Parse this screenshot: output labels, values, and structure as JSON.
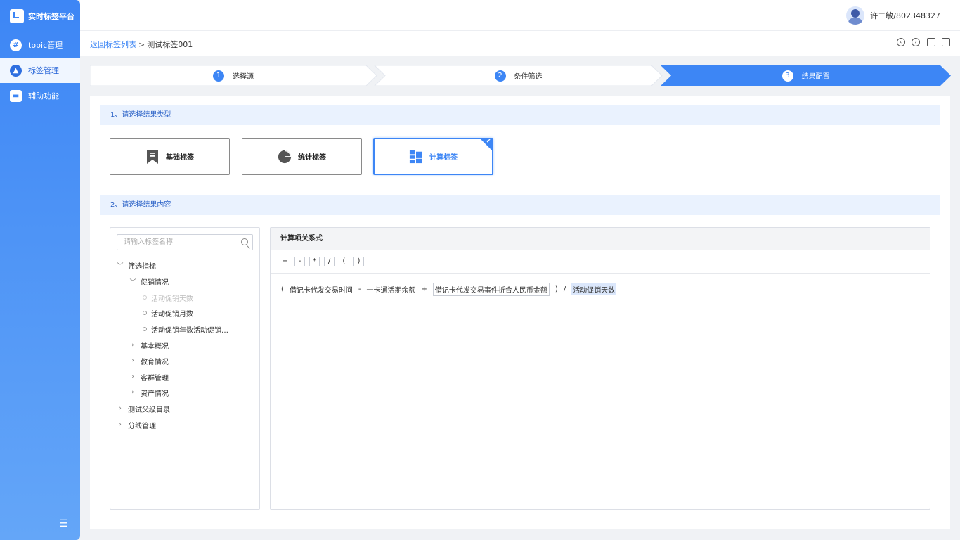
{
  "app": {
    "brand": "实时标签平台"
  },
  "sidebar": {
    "items": [
      {
        "label": "topic管理",
        "icon": "hash-icon",
        "active": false
      },
      {
        "label": "标签管理",
        "icon": "tag-badge-icon",
        "active": true
      },
      {
        "label": "辅助功能",
        "icon": "briefcase-icon",
        "active": false
      }
    ]
  },
  "user": {
    "name": "许二敏/802348327"
  },
  "breadcrumb": {
    "back": "返回标签列表",
    "sep": ">",
    "current": "测试标签001"
  },
  "steps": [
    {
      "num": "1",
      "label": "选择源"
    },
    {
      "num": "2",
      "label": "条件筛选"
    },
    {
      "num": "3",
      "label": "结果配置",
      "active": true
    }
  ],
  "section1": {
    "title": "1、请选择结果类型"
  },
  "types": [
    {
      "label": "基础标签",
      "icon": "bookmark-icon"
    },
    {
      "label": "统计标签",
      "icon": "pie-chart-icon"
    },
    {
      "label": "计算标签",
      "icon": "blocks-icon",
      "selected": true
    }
  ],
  "section2": {
    "title": "2、请选择结果内容"
  },
  "tree": {
    "search_placeholder": "请输入标签名称",
    "nodes": [
      {
        "label": "筛选指标",
        "expanded": true
      },
      {
        "label": "促销情况",
        "expanded": true
      },
      {
        "label": "活动促销天数",
        "disabled": true
      },
      {
        "label": "活动促销月数"
      },
      {
        "label": "活动促销年数活动促销…"
      },
      {
        "label": "基本概况"
      },
      {
        "label": "教育情况"
      },
      {
        "label": "客群管理"
      },
      {
        "label": "资产情况"
      },
      {
        "label": "测试父级目录"
      },
      {
        "label": "分线管理"
      }
    ]
  },
  "formula": {
    "title": "计算项关系式",
    "ops": [
      "+",
      "-",
      "*",
      "/",
      "(",
      ")"
    ],
    "tokens": [
      "(",
      "借记卡代发交易时间",
      "-",
      "一卡通活期余额",
      "+",
      "借记卡代发交易事件折合人民币金额",
      ")",
      "/",
      "活动促销天数"
    ]
  },
  "colors": {
    "accent": "#3d86f5",
    "section_bg": "#eaf2fe"
  }
}
